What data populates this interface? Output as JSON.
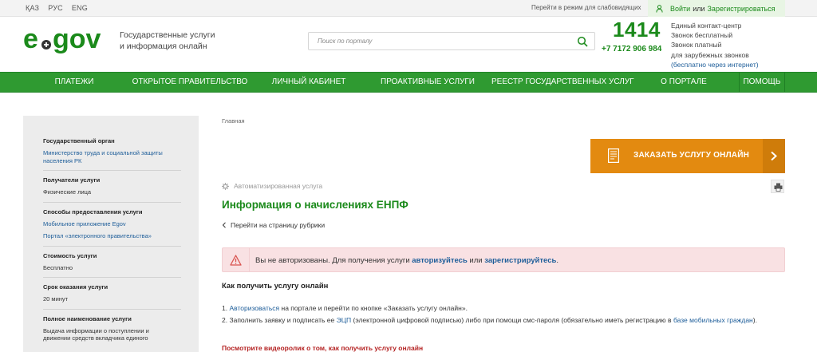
{
  "topbar": {
    "languages": [
      "ҚАЗ",
      "РУС",
      "ENG"
    ],
    "impaired_mode": "Перейти в режим для слабовидящих",
    "login": "Войти",
    "or": "или",
    "register": "Зарегистрироваться"
  },
  "header": {
    "logo": "egov",
    "tagline_line1": "Государственные услуги",
    "tagline_line2": "и информация онлайн",
    "search_placeholder": "Поиск по порталу",
    "hotline": "1414",
    "phone": "+7 7172 906 984",
    "contact_line1": "Единый контакт-центр",
    "contact_line2": "Звонок бесплатный",
    "contact_line3": "Звонок платный",
    "contact_line4": "для зарубежных звонков",
    "contact_line5": "(бесплатно через интернет)"
  },
  "nav": {
    "items": [
      "ПЛАТЕЖИ",
      "ОТКРЫТОЕ ПРАВИТЕЛЬСТВО",
      "ЛИЧНЫЙ КАБИНЕТ",
      "ПРОАКТИВНЫЕ УСЛУГИ",
      "РЕЕСТР ГОСУДАРСТВЕННЫХ УСЛУГ",
      "О ПОРТАЛЕ",
      "ПОМОЩЬ"
    ]
  },
  "sidebar": {
    "gov_body_title": "Государственный орган",
    "gov_body_line1": "Министерство труда и социальной защиты",
    "gov_body_line2": "населения РК",
    "recipients_title": "Получатели услуги",
    "recipients_value": "Физические лица",
    "methods_title": "Способы предоставления услуги",
    "method_mobile": "Мобильное приложение Egov",
    "method_portal": "Портал «электронного правительства»",
    "cost_title": "Стоимость услуги",
    "cost_value": "Бесплатно",
    "term_title": "Срок оказания услуги",
    "term_value": "20 минут",
    "fullname_title": "Полное наименование услуги",
    "fullname_line1": "Выдача информации о поступлении и",
    "fullname_line2": "движении средств вкладчика единого"
  },
  "main": {
    "breadcrumb": "Главная",
    "order_button": "ЗАКАЗАТЬ УСЛУГУ ОНЛАЙН",
    "service_type": "Автоматизированная услуга",
    "title": "Информация о начислениях ЕНПФ",
    "back_link": "Перейти на страницу рубрики",
    "alert_prefix": "Вы не авторизованы. Для получения услуги",
    "alert_authorize": "авторизуйтесь",
    "alert_or": "или",
    "alert_register": "зарегистрируйтесь",
    "alert_end": ".",
    "howto_title": "Как получить услугу онлайн",
    "step1_num": "1.",
    "step1_link": "Авторизоваться",
    "step1_rest": "на портале и перейти по кнопке «Заказать услугу онлайн».",
    "step2_num": "2.",
    "step2_text": "Заполнить заявку и подписать ее",
    "step2_link1": "ЭЦП",
    "step2_mid": "(электронной цифровой подписью) либо при помощи смс-пароля (обязательно иметь регистрацию в",
    "step2_link2": "базе мобильных граждан",
    "step2_end": ").",
    "video_link": "Посмотрите видеоролик о том, как получить услугу онлайн"
  },
  "colors": {
    "brand_green": "#2f9a31",
    "title_green": "#1b8a1b",
    "order_orange": "#e38a10",
    "link_blue": "#1d5d99",
    "alert_bg": "#f9e1e3",
    "video_red": "#b52424"
  }
}
